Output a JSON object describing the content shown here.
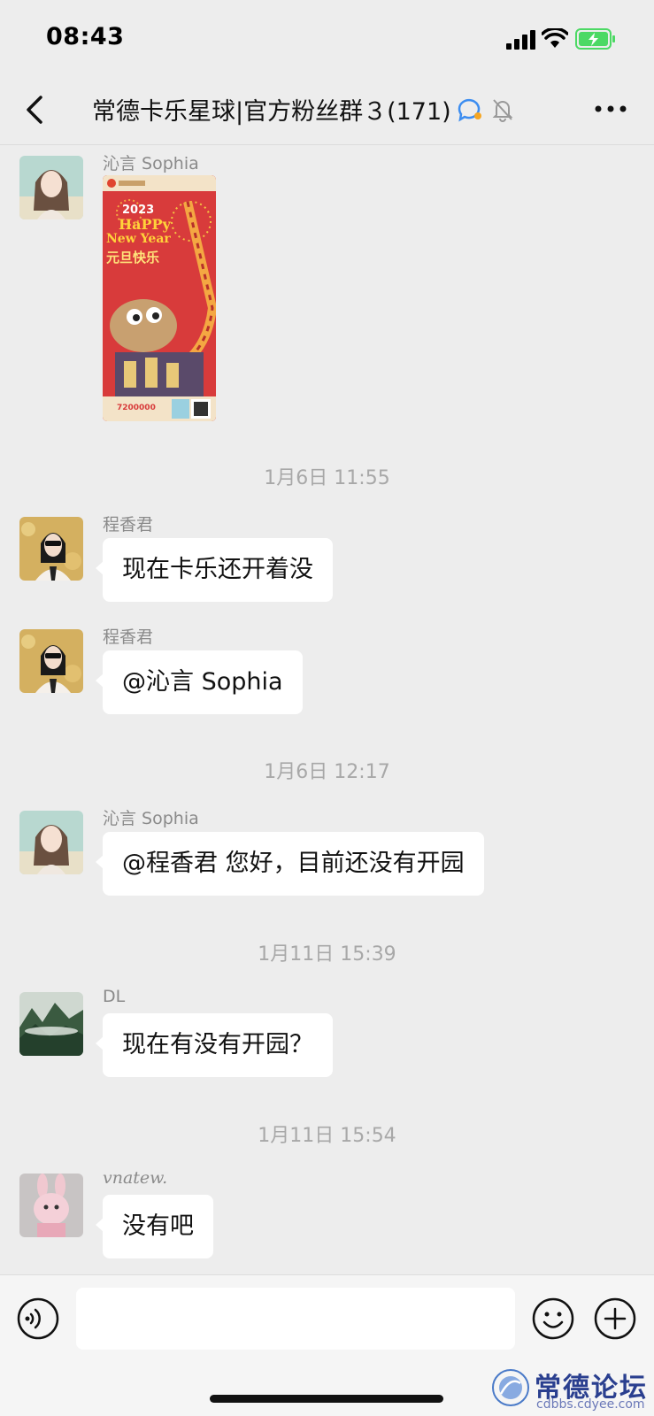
{
  "status_bar": {
    "time": "08:43"
  },
  "header": {
    "title": "常德卡乐星球|官方粉丝群３(171)"
  },
  "messages": [
    {
      "type": "image",
      "sender": "沁言 Sophia",
      "poster": {
        "year": "2023",
        "line1": "HaPPy",
        "line2": "New Year",
        "line3": "元旦快乐",
        "phone": "7200000"
      }
    },
    {
      "type": "time",
      "text": "1月6日 11:55"
    },
    {
      "type": "text",
      "sender": "程香君",
      "text": "现在卡乐还开着没"
    },
    {
      "type": "text",
      "sender": "程香君",
      "text": "@沁言 Sophia"
    },
    {
      "type": "time",
      "text": "1月6日 12:17"
    },
    {
      "type": "text",
      "sender": "沁言 Sophia",
      "text": "@程香君 您好，目前还没有开园"
    },
    {
      "type": "time",
      "text": "1月11日 15:39"
    },
    {
      "type": "text",
      "sender": "DL",
      "text": "现在有没有开园？"
    },
    {
      "type": "time",
      "text": "1月11日 15:54"
    },
    {
      "type": "text",
      "sender": "vnatew.",
      "text": "没有吧"
    }
  ],
  "input_bar": {
    "value": "",
    "placeholder": ""
  },
  "watermark": {
    "name": "常德论坛",
    "url": "cdbbs.cdyee.com"
  },
  "colors": {
    "background": "#ededed",
    "bubble": "#ffffff",
    "battery": "#4cd964",
    "watermark": "#2a3f8f"
  }
}
